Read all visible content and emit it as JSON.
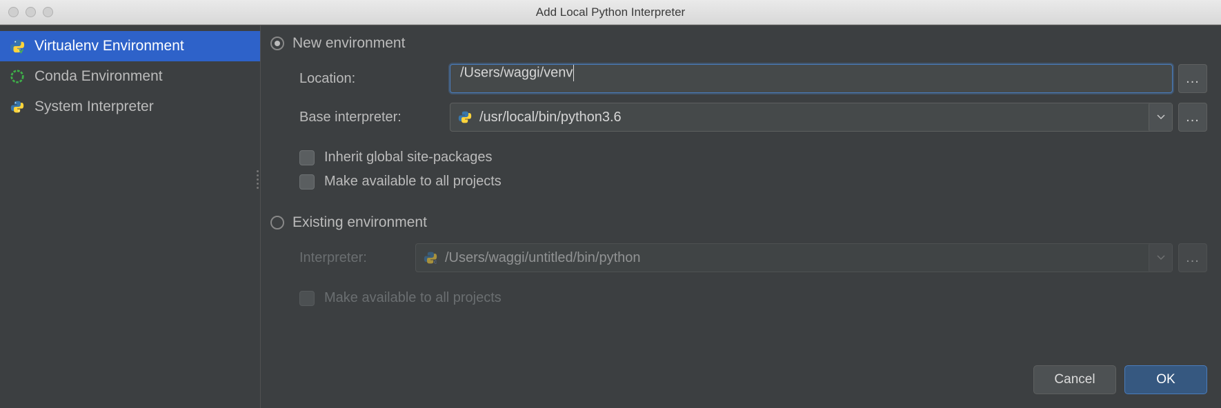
{
  "window": {
    "title": "Add Local Python Interpreter"
  },
  "sidebar": {
    "items": [
      {
        "label": "Virtualenv Environment"
      },
      {
        "label": "Conda Environment"
      },
      {
        "label": "System Interpreter"
      }
    ]
  },
  "main": {
    "new_env_label": "New environment",
    "existing_env_label": "Existing environment",
    "location_label": "Location:",
    "location_value": "/Users/waggi/venv",
    "base_label": "Base interpreter:",
    "base_value": "/usr/local/bin/python3.6",
    "inherit_label": "Inherit global site-packages",
    "make_avail_label": "Make available to all projects",
    "existing_interpreter_label": "Interpreter:",
    "existing_interpreter_value": "/Users/waggi/untitled/bin/python",
    "existing_make_avail_label": "Make available to all projects"
  },
  "footer": {
    "cancel": "Cancel",
    "ok": "OK"
  }
}
